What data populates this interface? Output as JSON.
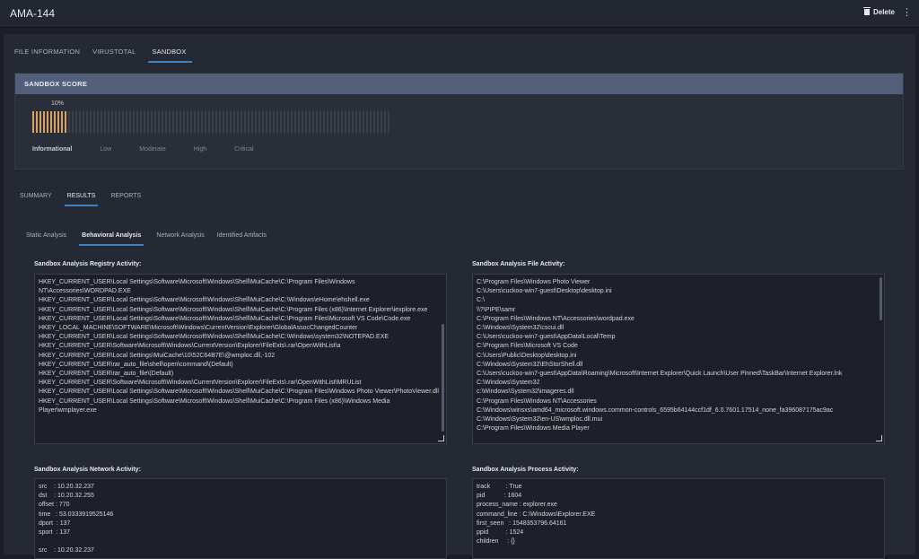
{
  "window": {
    "title": "AMA-144",
    "delete_label": "Delete"
  },
  "top_tabs": [
    {
      "label": "FILE INFORMATION"
    },
    {
      "label": "VIRUSTOTAL"
    },
    {
      "label": "SANDBOX"
    }
  ],
  "score": {
    "header": "SANDBOX SCORE",
    "percent_label": "10%",
    "fill_fraction": 0.1,
    "active_color": "#d9a066",
    "inactive_color": "#3a3f4a",
    "levels": [
      "Informational",
      "Low",
      "Moderate",
      "High",
      "Critical"
    ]
  },
  "result_tabs": [
    {
      "label": "SUMMARY"
    },
    {
      "label": "RESULTS"
    },
    {
      "label": "REPORTS"
    }
  ],
  "analysis_tabs": [
    {
      "label": "Static Analysis"
    },
    {
      "label": "Behavioral Analysis"
    },
    {
      "label": "Network Analysis"
    },
    {
      "label": "Identified Artifacts"
    }
  ],
  "sections": {
    "registry": {
      "title": "Sandbox Analysis Registry Activity:",
      "lines": [
        "HKEY_CURRENT_USER\\Local Settings\\Software\\Microsoft\\Windows\\Shell\\MuiCache\\C:\\Program Files\\Windows NT\\Accessories\\WORDPAD.EXE",
        "HKEY_CURRENT_USER\\Local Settings\\Software\\Microsoft\\Windows\\Shell\\MuiCache\\C:\\Windows\\eHome\\ehshell.exe",
        "HKEY_CURRENT_USER\\Local Settings\\Software\\Microsoft\\Windows\\Shell\\MuiCache\\C:\\Program Files (x86)\\Internet Explorer\\iexplore.exe",
        "HKEY_CURRENT_USER\\Local Settings\\Software\\Microsoft\\Windows\\Shell\\MuiCache\\C:\\Program Files\\Microsoft VS Code\\Code.exe",
        "HKEY_LOCAL_MACHINE\\SOFTWARE\\Microsoft\\Windows\\CurrentVersion\\Explorer\\GlobalAssocChangedCounter",
        "HKEY_CURRENT_USER\\Local Settings\\Software\\Microsoft\\Windows\\Shell\\MuiCache\\C:\\Windows\\system32\\NOTEPAD.EXE",
        "HKEY_CURRENT_USER\\Software\\Microsoft\\Windows\\CurrentVersion\\Explorer\\FileExts\\.rar\\OpenWithList\\a",
        "HKEY_CURRENT_USER\\Local Settings\\MuiCache\\10\\52C64B7E\\@wmploc.dll,-102",
        "HKEY_CURRENT_USER\\rar_auto_file\\shell\\open\\command\\(Default)",
        "HKEY_CURRENT_USER\\rar_auto_file\\(Default)",
        "HKEY_CURRENT_USER\\Software\\Microsoft\\Windows\\CurrentVersion\\Explorer\\FileExts\\.rar\\OpenWithList\\MRUList",
        "HKEY_CURRENT_USER\\Local Settings\\Software\\Microsoft\\Windows\\Shell\\MuiCache\\C:\\Program Files\\Windows Photo Viewer\\PhotoViewer.dll",
        "HKEY_CURRENT_USER\\Local Settings\\Software\\Microsoft\\Windows\\Shell\\MuiCache\\C:\\Program Files (x86)\\Windows Media Player\\wmplayer.exe"
      ]
    },
    "file": {
      "title": "Sandbox Analysis File Activity:",
      "lines": [
        "C:\\Program Files\\Windows Photo Viewer",
        "C:\\Users\\cuckoo-win7-guest\\Desktop\\desktop.ini",
        "C:\\",
        "\\\\?\\PIPE\\samr",
        "C:\\Program Files\\Windows NT\\Accessories\\wordpad.exe",
        "C:\\Windows\\System32\\cscui.dll",
        "C:\\Users\\cuckoo-win7-guest\\AppData\\Local\\Temp",
        "C:\\Program Files\\Microsoft VS Code",
        "C:\\Users\\Public\\Desktop\\desktop.ini",
        "C:\\Windows\\System32\\EhStorShell.dll",
        "C:\\Users\\cuckoo-win7-guest\\AppData\\Roaming\\Microsoft\\Internet Explorer\\Quick Launch\\User Pinned\\TaskBar\\Internet Explorer.lnk",
        "C:\\Windows\\System32",
        "c:\\Windows\\System32\\imageres.dll",
        "C:\\Program Files\\Windows NT\\Accessories",
        "C:\\Windows\\winsxs\\amd64_microsoft.windows.common-controls_6595b64144ccf1df_6.0.7601.17514_none_fa396087175ac9ac",
        "C:\\Windows\\System32\\en-US\\wmploc.dll.mui",
        "C:\\Program Files\\Windows Media Player"
      ]
    },
    "network": {
      "title": "Sandbox Analysis Network Activity:",
      "lines": [
        "src    : 10.20.32.237",
        "dst    : 10.20.32.255",
        "offset : 770",
        "time   : 53.0333919525146",
        "dport  : 137",
        "sport  : 137",
        "",
        "src    : 10.20.32.237"
      ]
    },
    "process": {
      "title": "Sandbox Analysis Process Activity:",
      "lines": [
        "track         : True",
        "pid           : 1604",
        "process_name : explorer.exe",
        "command_line : C:\\Windows\\Explorer.EXE",
        "first_seen   : 1548353796.64161",
        "ppid          : 1524",
        "children     : {}"
      ]
    }
  }
}
